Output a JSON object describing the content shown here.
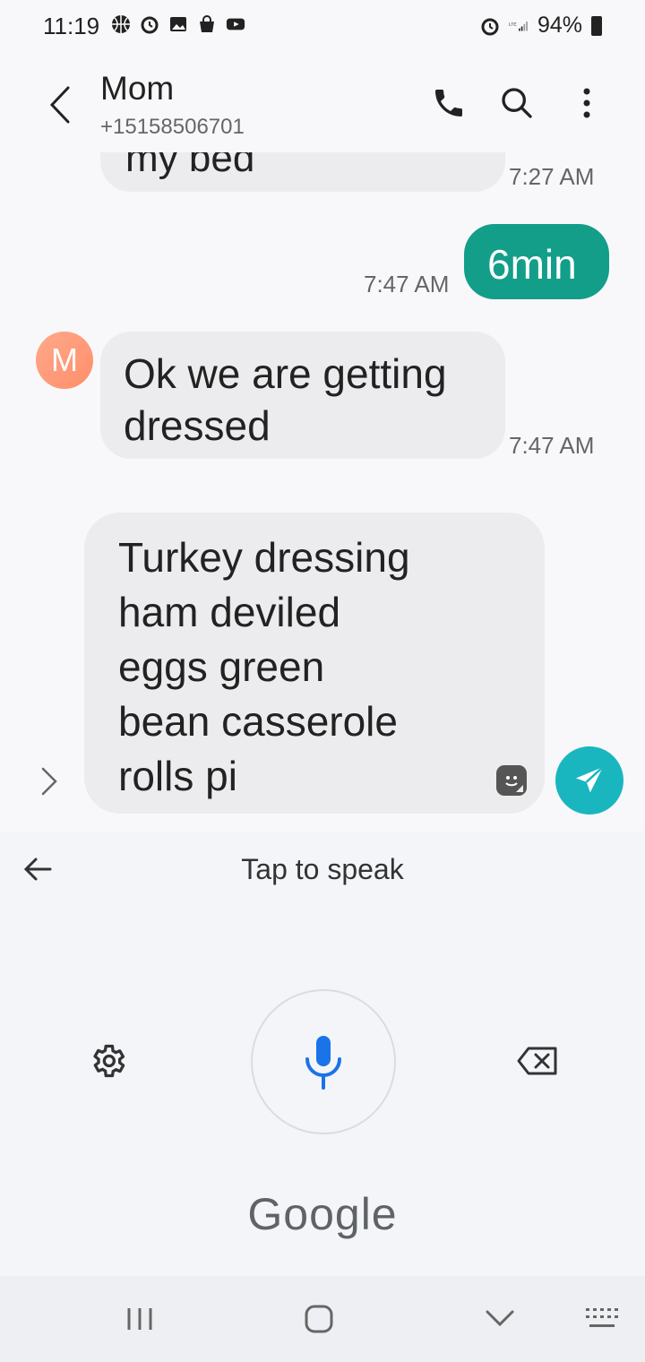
{
  "status_bar": {
    "time": "11:19",
    "battery": "94%"
  },
  "header": {
    "contact_name": "Mom",
    "phone": "+15158506701"
  },
  "messages": [
    {
      "direction": "in",
      "text": "my bed",
      "time": "7:27 AM"
    },
    {
      "direction": "out",
      "text": "6min",
      "time": "7:47 AM"
    },
    {
      "direction": "in",
      "text": "Ok we are getting dressed",
      "time": "7:47 AM",
      "avatar": "M"
    }
  ],
  "composer": {
    "text": "Turkey dressing\nham deviled\neggs green\nbean casserole\nrolls pi"
  },
  "voice": {
    "tap_to_speak": "Tap to speak",
    "brand": "Google"
  },
  "colors": {
    "outgoing_bubble": "#139e8a",
    "send_button": "#19b6c0",
    "mic": "#1a73e8"
  }
}
